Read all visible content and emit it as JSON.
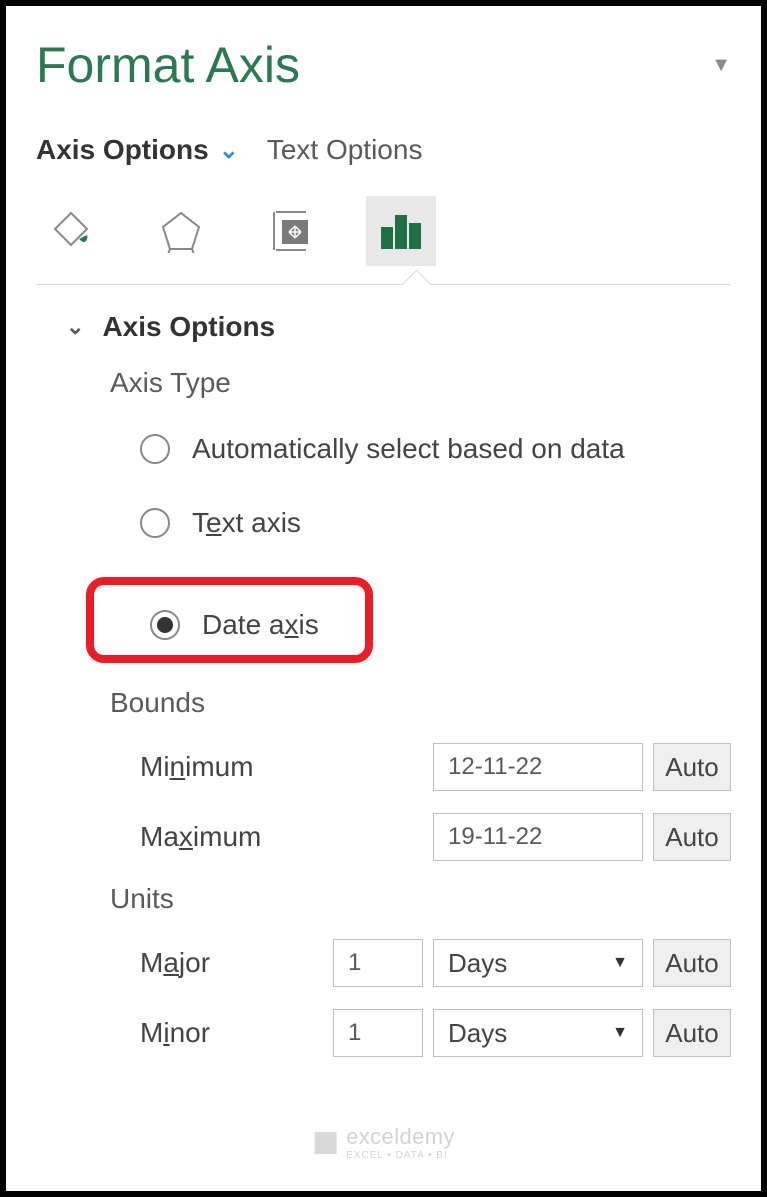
{
  "pane": {
    "title": "Format Axis"
  },
  "tabs": {
    "axis_options": "Axis Options",
    "text_options": "Text Options"
  },
  "section": {
    "axis_options": "Axis Options"
  },
  "axis_type": {
    "label": "Axis Type",
    "auto": "Automatically select based on data",
    "text_prefix": "T",
    "text_mid": "e",
    "text_suffix": "xt axis",
    "date_prefix": "Date a",
    "date_mid": "x",
    "date_suffix": "is"
  },
  "bounds": {
    "label": "Bounds",
    "min_prefix": "Mi",
    "min_mid": "n",
    "min_suffix": "imum",
    "max_prefix": "Ma",
    "max_mid": "x",
    "max_suffix": "imum",
    "min_value": "12-11-22",
    "max_value": "19-11-22",
    "auto": "Auto"
  },
  "units": {
    "label": "Units",
    "major_prefix": "M",
    "major_mid": "a",
    "major_suffix": "jor",
    "minor_pre": "M",
    "minor_mid1": "i",
    "minor_mid2": "nor",
    "major_value": "1",
    "minor_value": "1",
    "major_unit": "Days",
    "minor_unit": "Days",
    "auto": "Auto"
  },
  "watermark": {
    "brand": "exceldemy",
    "tagline": "EXCEL • DATA • BI"
  }
}
